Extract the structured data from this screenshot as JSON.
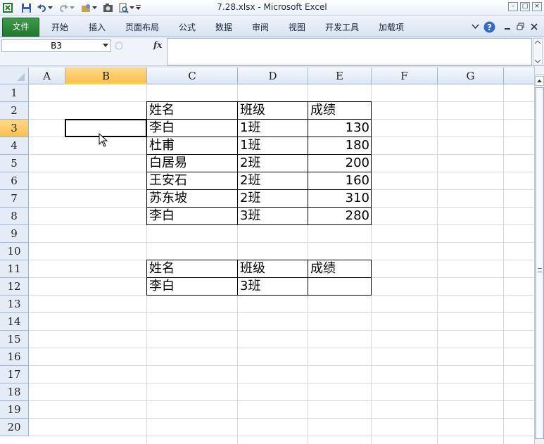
{
  "window": {
    "title": "7.28.xlsx  -  Microsoft Excel"
  },
  "ribbon": {
    "file_tab": "文件",
    "tabs": [
      "开始",
      "插入",
      "页面布局",
      "公式",
      "数据",
      "审阅",
      "视图",
      "开发工具",
      "加载项"
    ]
  },
  "formula_bar": {
    "name_box": "B3",
    "fx_label": "fx",
    "formula": ""
  },
  "grid": {
    "columns": [
      "A",
      "B",
      "C",
      "D",
      "E",
      "F",
      "G"
    ],
    "rows": [
      "1",
      "2",
      "3",
      "4",
      "5",
      "6",
      "7",
      "8",
      "9",
      "10",
      "11",
      "12",
      "13",
      "14",
      "15",
      "16",
      "17",
      "18",
      "19",
      "20"
    ],
    "selected_cell": "B3",
    "table1": {
      "headers": [
        "姓名",
        "班级",
        "成绩"
      ],
      "rows": [
        [
          "李白",
          "1班",
          "130"
        ],
        [
          "杜甫",
          "1班",
          "180"
        ],
        [
          "白居易",
          "2班",
          "200"
        ],
        [
          "王安石",
          "2班",
          "160"
        ],
        [
          "苏东坡",
          "2班",
          "310"
        ],
        [
          "李白",
          "3班",
          "280"
        ]
      ]
    },
    "table2": {
      "headers": [
        "姓名",
        "班级",
        "成绩"
      ],
      "rows": [
        [
          "李白",
          "3班",
          ""
        ]
      ]
    }
  },
  "colors": {
    "file_tab": "#2a8a36",
    "selected_header": "#f7c14f",
    "header_bg": "#e4ecf7",
    "gridline": "#d4d9df"
  }
}
